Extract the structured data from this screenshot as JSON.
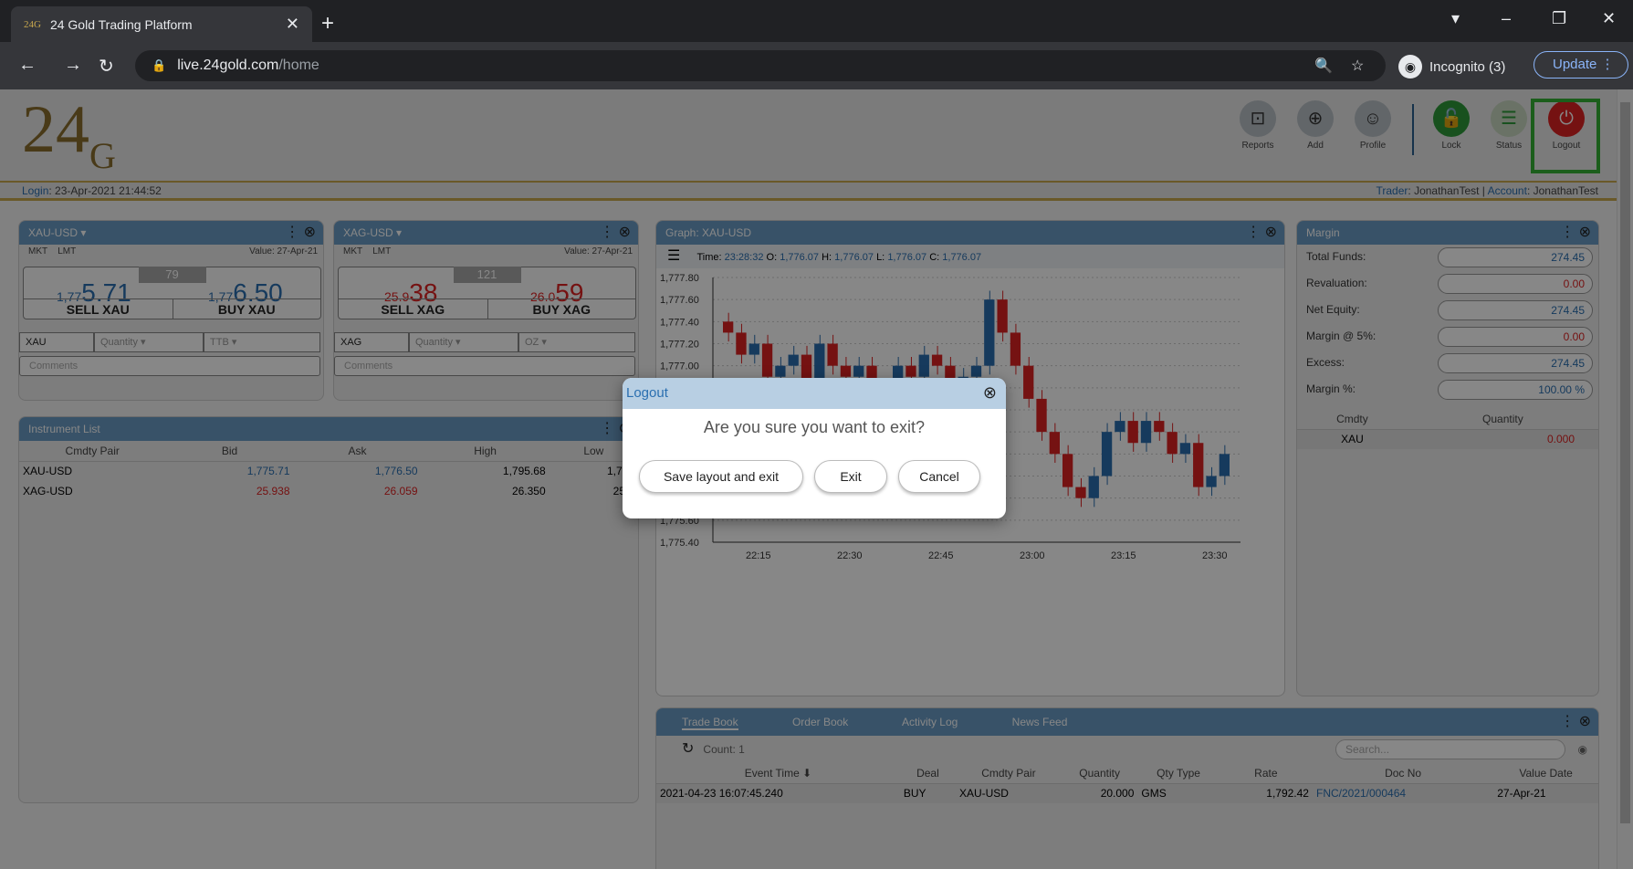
{
  "browser": {
    "tab_title": "24 Gold Trading Platform",
    "tab_favicon": "24G",
    "url_host": "live.24gold.com",
    "url_path": "/home",
    "incognito": "Incognito (3)",
    "update": "Update"
  },
  "app": {
    "logo_main": "24",
    "logo_sub": "G",
    "toolbar": [
      "Reports",
      "Add",
      "Profile",
      "Lock",
      "Status",
      "Logout"
    ],
    "login_label": "Login",
    "login_time": "23-Apr-2021 21:44:52",
    "trader_label": "Trader",
    "trader": "JonathanTest",
    "account_label": "Account",
    "account": "JonathanTest"
  },
  "quote_panels": [
    {
      "title": "XAU-USD ▾",
      "tab1": "MKT",
      "tab2": "LMT",
      "value": "Value: 27-Apr-21",
      "spread": "79",
      "sell_prefix": "1,77",
      "sell_big": "5.71",
      "buy_prefix": "1,77",
      "buy_big": "6.50",
      "sell_label": "SELL XAU",
      "buy_label": "BUY XAU",
      "cmdty": "XAU",
      "qty_ph": "Quantity",
      "unit": "TTB",
      "comments": "Comments"
    },
    {
      "title": "XAG-USD ▾",
      "tab1": "MKT",
      "tab2": "LMT",
      "value": "Value: 27-Apr-21",
      "spread": "121",
      "sell_prefix": "25.9",
      "sell_big": "38",
      "buy_prefix": "26.0",
      "buy_big": "59",
      "sell_label": "SELL XAG",
      "buy_label": "BUY XAG",
      "cmdty": "XAG",
      "qty_ph": "Quantity",
      "unit": "OZ",
      "comments": "Comments"
    }
  ],
  "instrument_list": {
    "title": "Instrument List",
    "headers": [
      "Cmdty Pair",
      "Bid",
      "Ask",
      "High",
      "Low"
    ],
    "rows": [
      [
        "XAU-USD",
        "1,775.71",
        "1,776.50",
        "1,795.68",
        "1,770"
      ],
      [
        "XAG-USD",
        "25.938",
        "26.059",
        "26.350",
        "25.9"
      ]
    ]
  },
  "graph": {
    "title": "Graph: XAU-USD",
    "time_label": "Time:",
    "time": "23:28:32",
    "o_label": "O:",
    "o": "1,776.07",
    "h_label": "H:",
    "h": "1,776.07",
    "l_label": "L:",
    "l": "1,776.07",
    "c_label": "C:",
    "c": "1,776.07"
  },
  "chart_data": {
    "type": "candlestick",
    "x_ticks": [
      "22:15",
      "22:30",
      "22:45",
      "23:00",
      "23:15",
      "23:30"
    ],
    "y_ticks": [
      "1,777.80",
      "1,777.60",
      "1,777.40",
      "1,777.20",
      "1,777.00",
      "1,776.80",
      "1,776.60",
      "1,776.40",
      "1,776.20",
      "1,776.00",
      "1,775.80",
      "1,775.60",
      "1,775.40"
    ],
    "ylim": [
      1775.4,
      1777.8
    ],
    "closes": [
      1777.3,
      1777.1,
      1777.2,
      1776.9,
      1777.0,
      1777.1,
      1776.8,
      1777.2,
      1777.0,
      1776.9,
      1777.0,
      1776.7,
      1776.8,
      1777.0,
      1776.9,
      1777.1,
      1777.0,
      1776.8,
      1776.9,
      1777.0,
      1777.6,
      1777.3,
      1777.0,
      1776.7,
      1776.4,
      1776.2,
      1775.9,
      1775.8,
      1776.0,
      1776.4,
      1776.5,
      1776.3,
      1776.5,
      1776.4,
      1776.2,
      1776.3,
      1775.9,
      1776.0,
      1776.2
    ]
  },
  "margin": {
    "title": "Margin",
    "rows": [
      {
        "label": "Total Funds:",
        "value": "274.45",
        "color": "#2a6fb0"
      },
      {
        "label": "Revaluation:",
        "value": "0.00",
        "color": "#d22"
      },
      {
        "label": "Net Equity:",
        "value": "274.45",
        "color": "#2a6fb0"
      },
      {
        "label": "Margin @ 5%:",
        "value": "0.00",
        "color": "#d22"
      },
      {
        "label": "Excess:",
        "value": "274.45",
        "color": "#2a6fb0"
      },
      {
        "label": "Margin %:",
        "value": "100.00 %",
        "color": "#2a6fb0"
      }
    ],
    "cmdty_header": "Cmdty",
    "qty_header": "Quantity",
    "cmdty": "XAU",
    "qty": "0.000"
  },
  "tradebook": {
    "tabs": [
      "Trade Book",
      "Order Book",
      "Activity Log",
      "News Feed"
    ],
    "count": "Count: 1",
    "search_ph": "Search...",
    "headers": [
      "Event Time ⬇",
      "Deal",
      "Cmdty Pair",
      "Quantity",
      "Qty Type",
      "Rate",
      "Doc No",
      "Value Date"
    ],
    "row": [
      "2021-04-23 16:07:45.240",
      "BUY",
      "XAU-USD",
      "20.000",
      "GMS",
      "1,792.42",
      "FNC/2021/000464",
      "27-Apr-21"
    ]
  },
  "modal": {
    "title": "Logout",
    "question": "Are you sure you want to exit?",
    "save_exit": "Save layout and exit",
    "exit": "Exit",
    "cancel": "Cancel"
  }
}
